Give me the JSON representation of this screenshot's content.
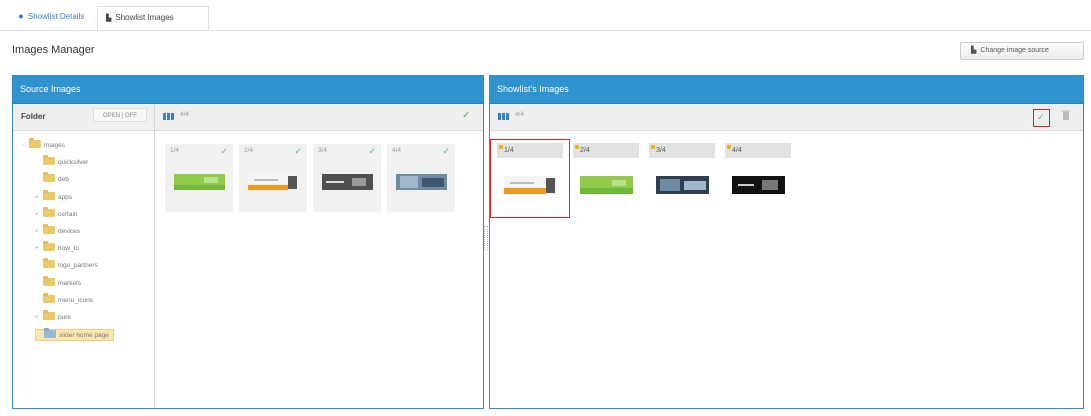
{
  "tabs": [
    {
      "label": "Showlist Details",
      "icon": "gear-icon"
    },
    {
      "label": "Showlist Images",
      "icon": "folder-icon"
    }
  ],
  "header": {
    "title": "Images Manager",
    "change_source_label": "Change image source"
  },
  "source_panel": {
    "title": "Source Images",
    "folder_label": "Folder",
    "toggle_label": "OPEN | OFF",
    "count": "4/4",
    "tree": [
      {
        "label": "images",
        "level": 0,
        "expander": "−"
      },
      {
        "label": "quicksilver",
        "level": 1,
        "expander": ""
      },
      {
        "label": "deb",
        "level": 1,
        "expander": ""
      },
      {
        "label": "apps",
        "level": 1,
        "expander": "+"
      },
      {
        "label": "certain",
        "level": 1,
        "expander": "+"
      },
      {
        "label": "devices",
        "level": 1,
        "expander": "+"
      },
      {
        "label": "how_to",
        "level": 1,
        "expander": "+"
      },
      {
        "label": "logo_partners",
        "level": 1,
        "expander": ""
      },
      {
        "label": "markets",
        "level": 1,
        "expander": ""
      },
      {
        "label": "menu_icons",
        "level": 1,
        "expander": ""
      },
      {
        "label": "pure",
        "level": 1,
        "expander": "+"
      },
      {
        "label": "slider home page",
        "level": 1,
        "expander": "",
        "selected": true
      }
    ],
    "thumbs": [
      {
        "label": "1/4",
        "image": "green-banner"
      },
      {
        "label": "2/4",
        "image": "orange-device-banner"
      },
      {
        "label": "3/4",
        "image": "dark-gray-banner"
      },
      {
        "label": "4/4",
        "image": "blue-photo-banner"
      }
    ]
  },
  "showlist_panel": {
    "title": "Showlist's Images",
    "count": "4/4",
    "items": [
      {
        "label": "1/4",
        "image": "orange-device-banner"
      },
      {
        "label": "2/4",
        "image": "green-banner"
      },
      {
        "label": "3/4",
        "image": "blue-photo-banner"
      },
      {
        "label": "4/4",
        "image": "black-banner"
      }
    ]
  },
  "colors": {
    "panel_header": "#2f93cf",
    "link_blue": "#3a7fbf",
    "check_green": "#5cb85c",
    "selection_red": "#dd2222",
    "folder_yellow": "#e9c96a"
  }
}
